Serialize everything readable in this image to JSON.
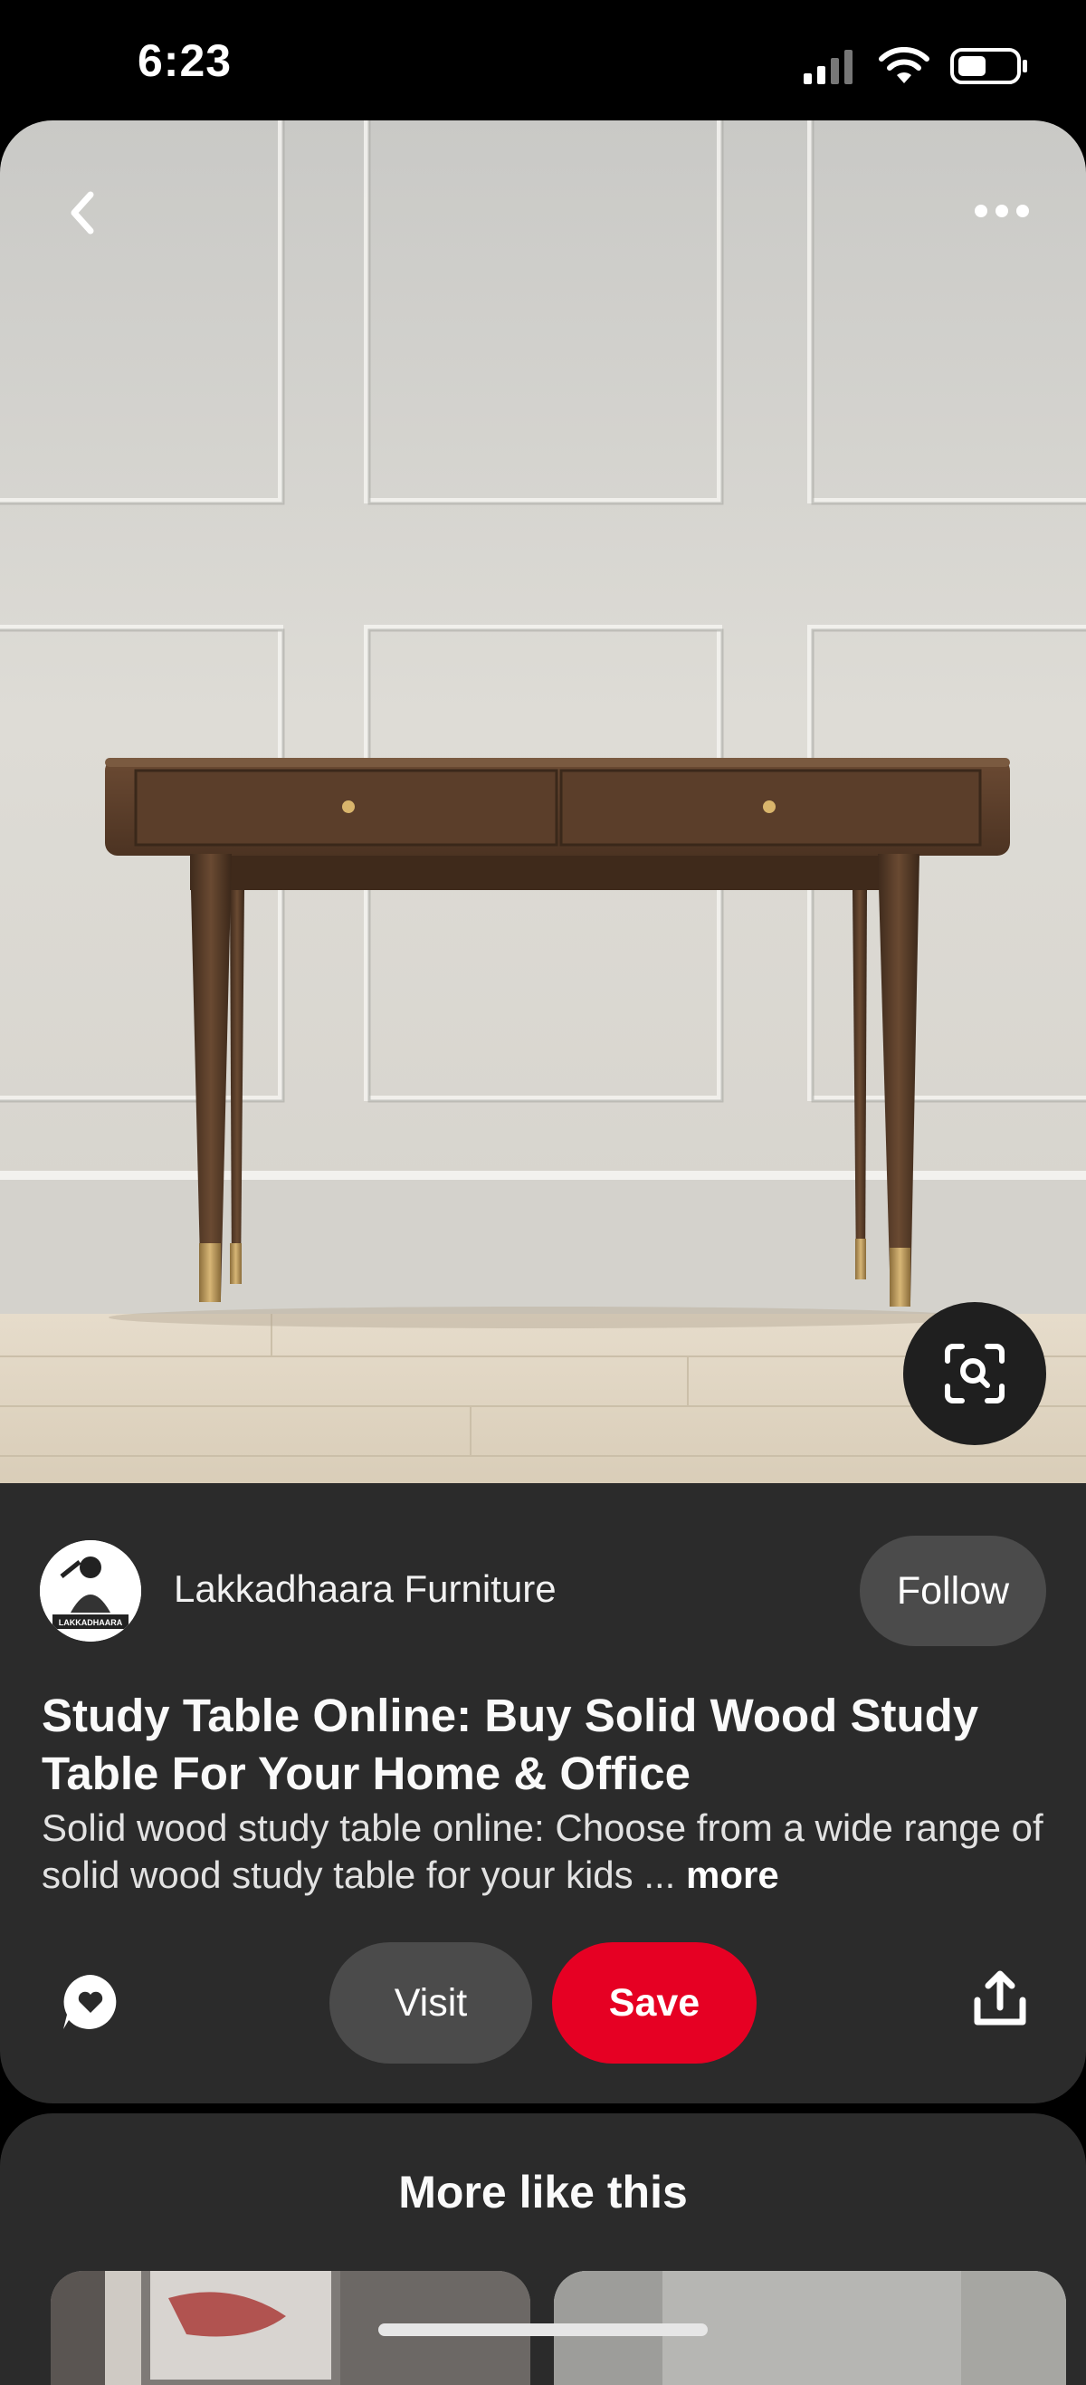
{
  "status_bar": {
    "time": "6:23",
    "icons": [
      "signal-icon",
      "wifi-icon",
      "battery-icon"
    ]
  },
  "pin": {
    "creator": {
      "name": "Lakkadhaara Furniture",
      "follow_label": "Follow",
      "avatar_text": "LAKKADHAARA"
    },
    "title": "Study Table Online: Buy Solid Wood Study Table For Your Home & Office",
    "description": "Solid wood study table online: Choose from a wide range of solid wood study table for your kids ...",
    "more_label": "more",
    "visit_label": "Visit",
    "save_label": "Save",
    "icons": [
      "chevron-left-icon",
      "more-dots-icon",
      "visual-search-icon",
      "comment-icon",
      "share-icon"
    ]
  },
  "more_like_this": {
    "title": "More like this"
  },
  "colors": {
    "background": "#2b2b2b",
    "save_red": "#e60023",
    "pill_gray": "#4b4b4b"
  }
}
